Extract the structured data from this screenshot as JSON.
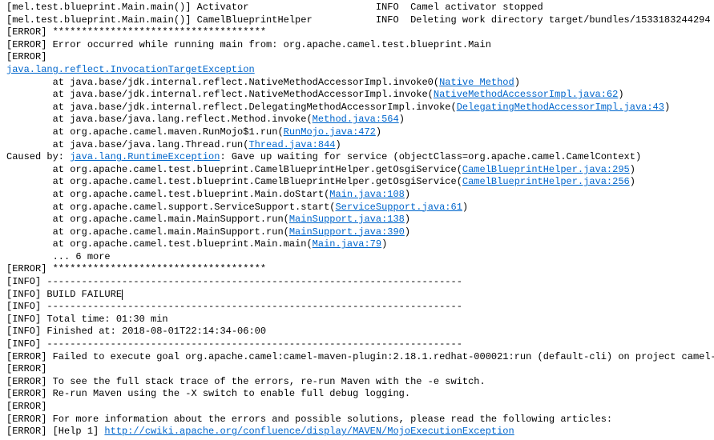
{
  "lines": {
    "l1_a": "[mel.test.blueprint.Main.main()] Activator                      INFO  Camel activator stopped",
    "l2_a": "[mel.test.blueprint.Main.main()] CamelBlueprintHelper           INFO  Deleting work directory target/bundles/1533183244294",
    "l3": "[ERROR] *************************************",
    "l4": "[ERROR] Error occurred while running main from: org.apache.camel.test.blueprint.Main",
    "l5": "[ERROR]",
    "l6_link": "java.lang.reflect.InvocationTargetException",
    "l7_a": "        at java.base/jdk.internal.reflect.NativeMethodAccessorImpl.invoke0(",
    "l7_link": "Native Method",
    "l7_b": ")",
    "l8_a": "        at java.base/jdk.internal.reflect.NativeMethodAccessorImpl.invoke(",
    "l8_link": "NativeMethodAccessorImpl.java:62",
    "l8_b": ")",
    "l9_a": "        at java.base/jdk.internal.reflect.DelegatingMethodAccessorImpl.invoke(",
    "l9_link": "DelegatingMethodAccessorImpl.java:43",
    "l9_b": ")",
    "l10_a": "        at java.base/java.lang.reflect.Method.invoke(",
    "l10_link": "Method.java:564",
    "l10_b": ")",
    "l11_a": "        at org.apache.camel.maven.RunMojo$1.run(",
    "l11_link": "RunMojo.java:472",
    "l11_b": ")",
    "l12_a": "        at java.base/java.lang.Thread.run(",
    "l12_link": "Thread.java:844",
    "l12_b": ")",
    "l13_a": "Caused by: ",
    "l13_link": "java.lang.RuntimeException",
    "l13_b": ": Gave up waiting for service (objectClass=org.apache.camel.CamelContext)",
    "l14_a": "        at org.apache.camel.test.blueprint.CamelBlueprintHelper.getOsgiService(",
    "l14_link": "CamelBlueprintHelper.java:295",
    "l14_b": ")",
    "l15_a": "        at org.apache.camel.test.blueprint.CamelBlueprintHelper.getOsgiService(",
    "l15_link": "CamelBlueprintHelper.java:256",
    "l15_b": ")",
    "l16_a": "        at org.apache.camel.test.blueprint.Main.doStart(",
    "l16_link": "Main.java:108",
    "l16_b": ")",
    "l17_a": "        at org.apache.camel.support.ServiceSupport.start(",
    "l17_link": "ServiceSupport.java:61",
    "l17_b": ")",
    "l18_a": "        at org.apache.camel.main.MainSupport.run(",
    "l18_link": "MainSupport.java:138",
    "l18_b": ")",
    "l19_a": "        at org.apache.camel.main.MainSupport.run(",
    "l19_link": "MainSupport.java:390",
    "l19_b": ")",
    "l20_a": "        at org.apache.camel.test.blueprint.Main.main(",
    "l20_link": "Main.java:79",
    "l20_b": ")",
    "l21": "        ... 6 more",
    "l22": "[ERROR] *************************************",
    "l23": "[INFO] ------------------------------------------------------------------------",
    "l24": "[INFO] BUILD FAILURE",
    "l25": "[INFO] ------------------------------------------------------------------------",
    "l26": "[INFO] Total time: 01:30 min",
    "l27": "[INFO] Finished at: 2018-08-01T22:14:34-06:00",
    "l28": "[INFO] ------------------------------------------------------------------------",
    "l29": "[ERROR] Failed to execute goal org.apache.camel:camel-maven-plugin:2.18.1.redhat-000021:run (default-cli) on project camel-bl",
    "l30": "[ERROR]",
    "l31": "[ERROR] To see the full stack trace of the errors, re-run Maven with the -e switch.",
    "l32": "[ERROR] Re-run Maven using the -X switch to enable full debug logging.",
    "l33": "[ERROR]",
    "l34": "[ERROR] For more information about the errors and possible solutions, please read the following articles:",
    "l35_a": "[ERROR] [Help 1] ",
    "l35_link": "http://cwiki.apache.org/confluence/display/MAVEN/MojoExecutionException"
  }
}
